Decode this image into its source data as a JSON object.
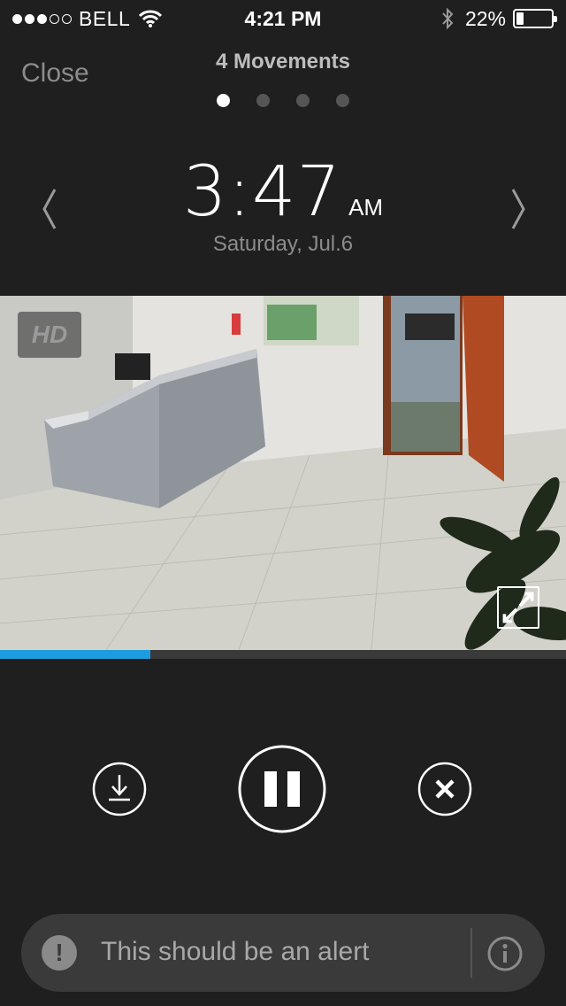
{
  "status_bar": {
    "carrier": "BELL",
    "time": "4:21 PM",
    "battery_percent": "22%",
    "battery_level": 0.22,
    "signal_strength": 3,
    "signal_max": 5
  },
  "header": {
    "close_label": "Close",
    "title": "4 Movements",
    "pages": 4,
    "active_page": 1
  },
  "clock": {
    "hour": "3",
    "minute": "47",
    "ampm": "AM",
    "date": "Saturday, Jul.6"
  },
  "video": {
    "hd_label": "HD",
    "progress": 0.265,
    "progress_color": "#1e9ce0"
  },
  "alert": {
    "message": "This should be an alert"
  }
}
